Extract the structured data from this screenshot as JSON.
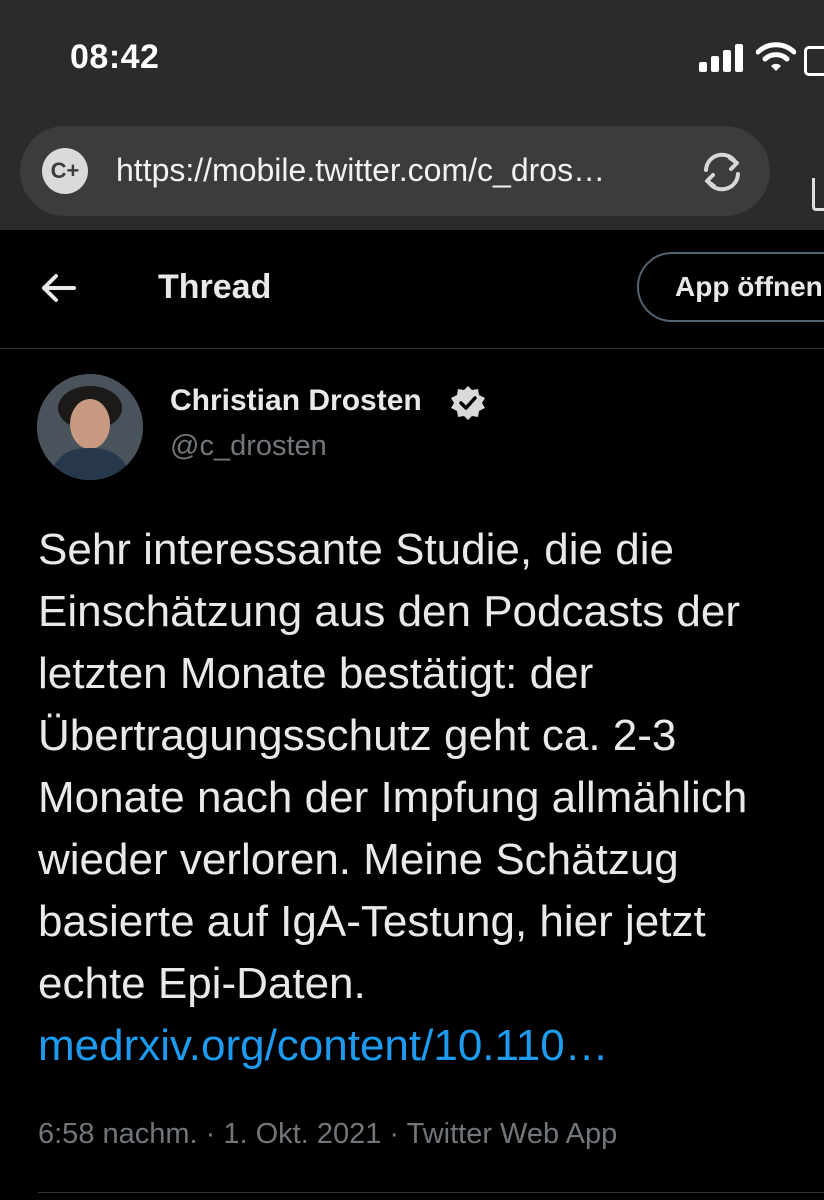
{
  "status_bar": {
    "time": "08:42"
  },
  "browser": {
    "url": "https://mobile.twitter.com/c_dros…",
    "site_badge": "C+"
  },
  "header": {
    "title": "Thread",
    "open_app_label": "App öffnen"
  },
  "tweet": {
    "author_name": "Christian Drosten",
    "handle": "@c_drosten",
    "text_lines": [
      "Sehr interessante Studie, die die",
      "Einschätzung aus den Podcasts der",
      "letzten Monate bestätigt: der",
      "Übertragungsschutz geht ca. 2-3",
      "Monate nach der Impfung allmählich",
      "wieder verloren. Meine Schätzug",
      "basierte auf IgA-Testung, hier jetzt",
      "echte Epi-Daten."
    ],
    "link": "medrxiv.org/content/10.110…",
    "timestamp": "6:58 nachm. · 1. Okt. 2021 · Twitter Web App"
  },
  "colors": {
    "background": "#000000",
    "chrome": "#2b2b2b",
    "link": "#1d9bf0",
    "secondary_text": "#71767b"
  }
}
